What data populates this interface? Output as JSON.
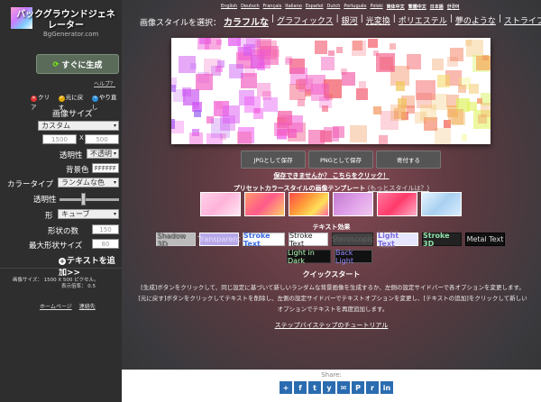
{
  "sidebar": {
    "logo_title": "バックグラウンドジェネレーター",
    "logo_sub": "BgGenerator.com",
    "generate_label": "すぐに生成",
    "help_label": "ヘルプ？",
    "actions": {
      "clear": "クリア",
      "undo": "元に戻す",
      "redo": "やり直し"
    },
    "image_size_label": "画像サイズ",
    "size_select": "カスタム",
    "width_placeholder": "1500",
    "x_label": "X",
    "height_placeholder": "500",
    "transparency_label": "透明性",
    "transparency_select": "不透明",
    "bgcolor_label": "背景色",
    "bgcolor_value": "FFFFFF",
    "colortype_label": "カラータイプ",
    "colortype_select": "ランダムな色",
    "opacity_label": "透明性",
    "opacity_level": 0.4,
    "shape_label": "形",
    "shape_select": "キューブ",
    "shape_count_label": "形状の数",
    "shape_count_placeholder": "150",
    "max_shape_label": "最大形状サイズ",
    "max_shape_placeholder": "80",
    "add_text_label": "テキストを追加>>",
    "size_info_label": "画像サイズ：",
    "size_info_value": "1500 X 500 ピクセル。",
    "display_ratio": "表示倍率：",
    "display_ratio_value": "0.5",
    "footer_home": "ホームページ",
    "footer_contact": "連絡先"
  },
  "languages": [
    "English",
    "Deutsch",
    "Français",
    "Italiano",
    "Español",
    "Dutch",
    "Português",
    "Polski",
    "简体中文",
    "繁體中文",
    "日本語",
    "한국어"
  ],
  "style_prompt": "画像スタイルを選択：",
  "styles": [
    "カラフルな",
    "グラフィックス",
    "銀河",
    "光変換",
    "ポリエステル",
    "夢のような",
    "ストライプ"
  ],
  "styles_selected": "カラフルな",
  "save_buttons": {
    "jpg": "JPGとして保存",
    "png": "PNGとして保存",
    "donate": "寄付する"
  },
  "save_question": "保存できませんか？ こちらをクリック！",
  "preset_title": "プリセットカラースタイルの画像テンプレート",
  "preset_more": "(もっとスタイルは？)",
  "text_effects_title": "テキスト効果",
  "text_effects_row1": [
    "Shadow 3D",
    "Transparent",
    "Stroke Text",
    "Stroke Text",
    "Steroscopic",
    "Inset",
    "Light Text",
    "Stroke 3D",
    "Metal Text"
  ],
  "text_effects_row2": [
    "Light in Dark",
    "Back Light"
  ],
  "quickstart_title": "クイックスタート",
  "quickstart_text": "[生成]ボタンをクリックして、同じ設定に基づいて新しいランダムな背景画像を生成するか、左側の設定サイドバーで各オプションを変更します。 [元に戻す]ボタンをクリックしてテキストを削除し、左側の設定サイドバーでテキストオプションを変更し、[テキストの追加]をクリックして新しいオプションでテキストを再度追加します。",
  "tutorial_link": "ステップバイステップのチュートリアル",
  "share_label": "Share:",
  "share_icons": [
    "+",
    "f",
    "t",
    "y",
    "✉",
    "P",
    "r",
    "in"
  ],
  "colors": {
    "sidebar_bg": "#2e2e2e",
    "share_blue": "#2b6cb0"
  }
}
